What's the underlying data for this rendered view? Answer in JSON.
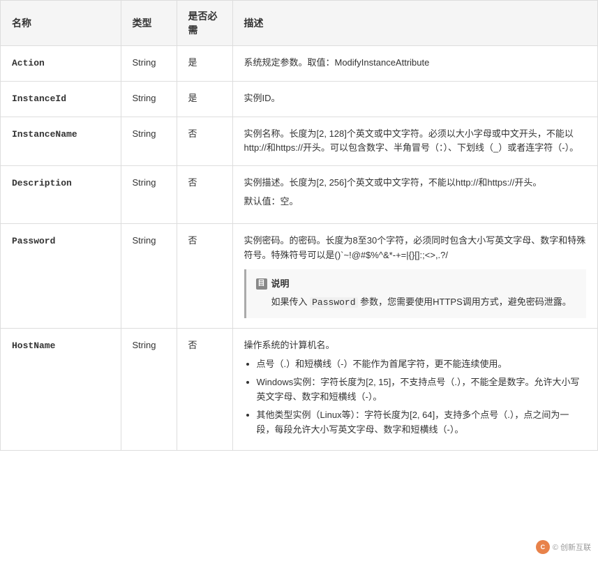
{
  "table": {
    "headers": [
      "名称",
      "类型",
      "是否必需",
      "描述"
    ],
    "rows": [
      {
        "name": "Action",
        "type": "String",
        "required": "是",
        "description": "系统规定参数。取值：ModifyInstanceAttribute",
        "description_plain": true
      },
      {
        "name": "InstanceId",
        "type": "String",
        "required": "是",
        "description": "实例ID。",
        "description_plain": true
      },
      {
        "name": "InstanceName",
        "type": "String",
        "required": "否",
        "description": "实例名称。长度为[2, 128]个英文或中文字符。必须以大小字母或中文开头，不能以http://和https://开头。可以包含数字、半角冒号（：）、下划线（_）或者连字符（-）。",
        "description_plain": true
      },
      {
        "name": "Description",
        "type": "String",
        "required": "否",
        "description_lines": [
          "实例描述。长度为[2, 256]个英文或中文字符，不能以http://和https://开头。",
          "默认值：空。"
        ],
        "has_note": false
      },
      {
        "name": "Password",
        "type": "String",
        "required": "否",
        "description_main": "实例密码。的密码。长度为8至30个字符，必须同时包含大小写英文字母、数字和特殊符号。特殊符号可以是()`~!@#$%^&*-+=|{}[]:;<>,.?/",
        "note_title": "说明",
        "note_content": "如果传入 Password 参数，您需要使用HTTPS调用方式，避免密码泄露。",
        "has_note": true
      },
      {
        "name": "HostName",
        "type": "String",
        "required": "否",
        "description_intro": "操作系统的计算机名。",
        "bullets": [
          "点号（.）和短横线（-）不能作为首尾字符，更不能连续使用。",
          "Windows实例：字符长度为[2, 15]，不支持点号（.），不能全是数字。允许大小写英文字母、数字和短横线（-）。",
          "其他类型实例（Linux等）：字符长度为[2, 64]，支持多个点号（.），点之间为一段，每段允许大小写英文字母、数字和短横线（-）。"
        ]
      }
    ]
  },
  "watermark": {
    "text": "© 创新互联",
    "icon_label": "C"
  }
}
